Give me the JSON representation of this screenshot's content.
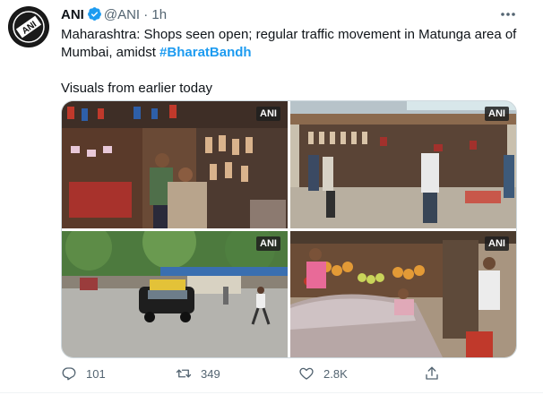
{
  "tweet": {
    "author_name": "ANI",
    "handle": "@ANI",
    "separator": "·",
    "time": "1h",
    "avatar_text": "ANI",
    "text_line1": "Maharashtra: Shops seen open; regular traffic movement in Matunga area of Mumbai, amidst ",
    "hashtag": "#BharatBandh",
    "text_line2": "Visuals from earlier today"
  },
  "media": {
    "photos": [
      {
        "watermark": "ANI",
        "subject": "footwear shop with hanging shoes and shoppers"
      },
      {
        "watermark": "ANI",
        "subject": "street-side shoe stall with people standing"
      },
      {
        "watermark": "ANI",
        "subject": "street with taxi and pedestrians under trees"
      },
      {
        "watermark": "ANI",
        "subject": "fruit stall with vendor and parked car"
      }
    ]
  },
  "actions": {
    "reply_count": "101",
    "retweet_count": "349",
    "like_count": "2.8K"
  },
  "icons": {
    "reply": "reply-icon",
    "retweet": "retweet-icon",
    "like": "heart-icon",
    "share": "share-icon",
    "more": "more-icon",
    "verified": "verified-badge-icon"
  },
  "colors": {
    "accent": "#1d9bf0",
    "muted": "#536471",
    "text": "#0f1419"
  }
}
